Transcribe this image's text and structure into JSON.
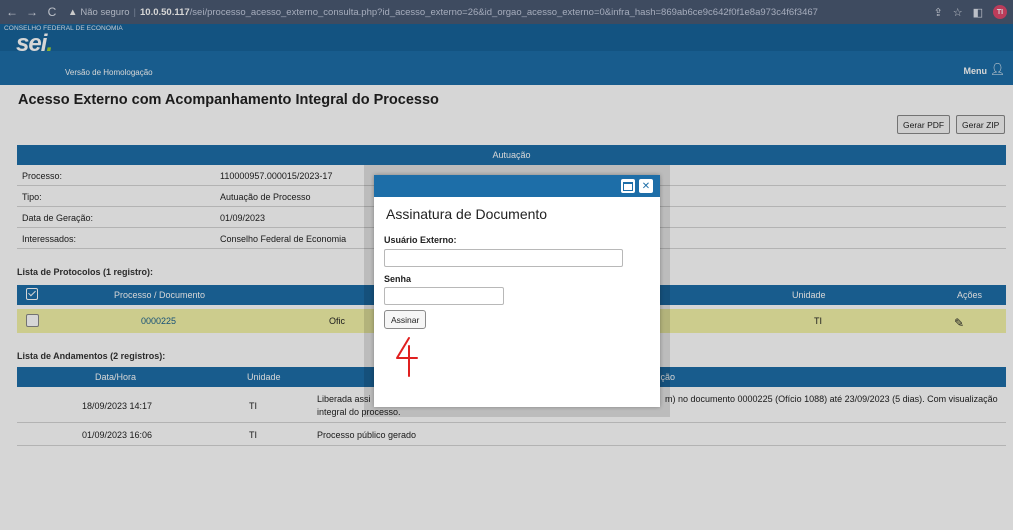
{
  "browser": {
    "warning": "Não seguro",
    "url_host": "10.0.50.117",
    "url_path": "/sei/processo_acesso_externo_consulta.php?id_acesso_externo=26&id_orgao_acesso_externo=0&infra_hash=869ab6ce9c642f0f1e8a973c4f6f3467",
    "profile_initials": "TI"
  },
  "header": {
    "org_name": "CONSELHO FEDERAL DE ECONOMIA",
    "logo_text": "sei",
    "logo_dot": ".",
    "environment": "Versão de Homologação",
    "menu_label": "Menu"
  },
  "page": {
    "title": "Acesso Externo com Acompanhamento Integral do Processo",
    "btn_pdf": "Gerar PDF",
    "btn_zip": "Gerar ZIP"
  },
  "autuacao": {
    "header": "Autuação",
    "rows": [
      {
        "label": "Processo:",
        "value": "110000957.000015/2023-17"
      },
      {
        "label": "Tipo:",
        "value": "Autuação de Processo"
      },
      {
        "label": "Data de Geração:",
        "value": "01/09/2023"
      },
      {
        "label": "Interessados:",
        "value": "Conselho Federal de Economia"
      }
    ]
  },
  "protocolos": {
    "title": "Lista de Protocolos (1 registro):",
    "headers": {
      "doc": "Processo / Documento",
      "unidade": "Unidade",
      "acoes": "Ações"
    },
    "row": {
      "doc": "0000225",
      "tipo_partial": "Ofic",
      "unidade": "TI"
    }
  },
  "andamentos": {
    "title": "Lista de Andamentos (2 registros):",
    "headers": {
      "data": "Data/Hora",
      "unidade": "Unidade",
      "descricao_partial": "crição"
    },
    "rows": [
      {
        "data": "18/09/2023 14:17",
        "unidade": "TI",
        "desc_a": "Liberada assi",
        "desc_b": "m) no documento 0000225 (Ofício 1088) até 23/09/2023 (5 dias). Com visualização",
        "desc_c": "integral do processo."
      },
      {
        "data": "01/09/2023 16:06",
        "unidade": "TI",
        "desc_a": "Processo público gerado",
        "desc_b": "",
        "desc_c": ""
      }
    ]
  },
  "modal": {
    "title": "Assinatura de Documento",
    "user_label": "Usuário Externo:",
    "user_value": "",
    "password_label": "Senha",
    "password_value": "",
    "submit_label": "Assinar"
  },
  "colors": {
    "primary": "#1d6ea8",
    "highlight_row": "#f4f4a8",
    "annotation": "#e02020"
  }
}
